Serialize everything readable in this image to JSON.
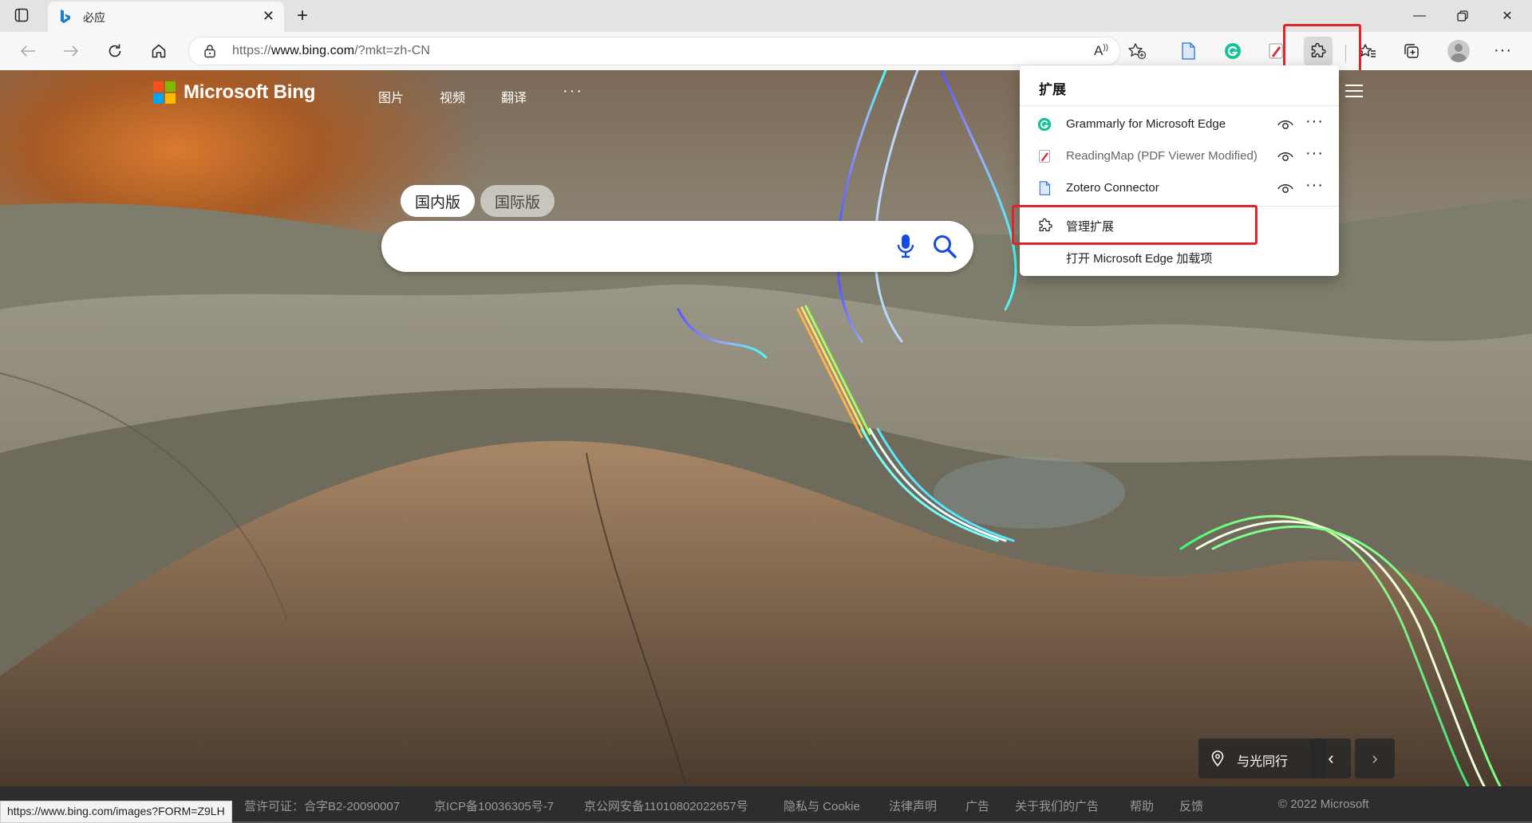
{
  "browser": {
    "tab_title": "必应",
    "address": {
      "scheme_prefix": "https://",
      "host": "www.bing.com",
      "path": "/?mkt=zh-CN"
    },
    "status_url": "https://www.bing.com/images?FORM=Z9LH"
  },
  "bing": {
    "logo_text": "Microsoft Bing",
    "nav": [
      "图片",
      "视频",
      "翻译",
      "···"
    ],
    "edition_tabs": [
      "国内版",
      "国际版"
    ],
    "location_label": "与光同行",
    "footer_links": [
      "营许可证：合字B2-20090007",
      "京ICP备10036305号-7",
      "京公网安备11010802022657号",
      "隐私与 Cookie",
      "法律声明",
      "广告",
      "关于我们的广告",
      "帮助",
      "反馈",
      "© 2022 Microsoft"
    ]
  },
  "extensions_menu": {
    "title": "扩展",
    "items": [
      {
        "label": "Grammarly for Microsoft Edge",
        "icon": "grammarly-icon"
      },
      {
        "label": "ReadingMap (PDF Viewer Modified)",
        "icon": "readingmap-icon"
      },
      {
        "label": "Zotero Connector",
        "icon": "zotero-icon"
      }
    ],
    "manage_label": "管理扩展",
    "open_addons_label": "打开 Microsoft Edge 加载项"
  },
  "colors": {
    "highlight_red": "#e0242b",
    "grammarly_green": "#15c39a",
    "zotero_blue": "#2f6fd6"
  }
}
